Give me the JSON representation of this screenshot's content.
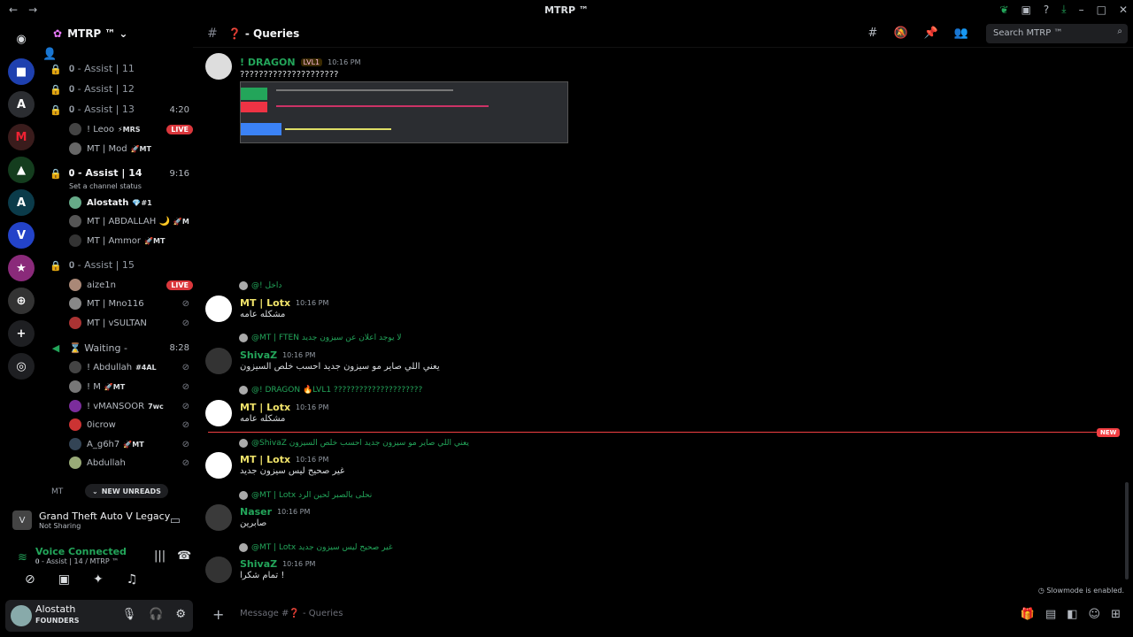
{
  "window": {
    "title": "MTRP ™"
  },
  "server": {
    "name": "MTRP ™"
  },
  "channel": {
    "name": "❓ - Queries"
  },
  "search": {
    "placeholder": "Search MTRP ™"
  },
  "channels": [
    {
      "label": "𝟎 - Assist | 11",
      "time": ""
    },
    {
      "label": "𝟎 - Assist | 12",
      "time": ""
    },
    {
      "label": "𝟎 - Assist | 13",
      "time": "4:20"
    },
    {
      "label": "𝟎 - Assist | 14",
      "time": "9:16"
    },
    {
      "label": "𝟎 - Assist | 15",
      "time": ""
    }
  ],
  "assist13_users": [
    {
      "name": "! Leoo",
      "tag": "⚡MRS",
      "live": "LIVE"
    },
    {
      "name": "MT | Mod",
      "tag": "🚀MT",
      "live": ""
    }
  ],
  "assist14_status": "Set a channel status",
  "assist14_users": [
    {
      "name": "Alostath",
      "tag": "💎#1"
    },
    {
      "name": "MT | ABDALLAH 🌙",
      "tag": "🚀M"
    },
    {
      "name": "MT | Ammor",
      "tag": "🚀MT"
    }
  ],
  "assist15_users": [
    {
      "name": "aize1n",
      "live": "LIVE"
    },
    {
      "name": "MT | Mno116",
      "live": ""
    },
    {
      "name": "MT | vSULTAN",
      "live": ""
    }
  ],
  "waiting": {
    "label": "⌛ Waiting -",
    "time": "8:28"
  },
  "waiting_users": [
    {
      "name": "! Abdullah",
      "tag": "#4AL"
    },
    {
      "name": "! M",
      "tag": "🚀MT"
    },
    {
      "name": "! vMANSOOR",
      "tag": "7wc"
    },
    {
      "name": "0icrow",
      "tag": ""
    },
    {
      "name": "A_g6h7",
      "tag": "🚀MT"
    },
    {
      "name": "Abdullah",
      "tag": ""
    }
  ],
  "category": "MT",
  "new_unreads": "NEW UNREADS",
  "activity": {
    "game": "Grand Theft Auto V Legacy",
    "status": "Not Sharing"
  },
  "voice": {
    "status": "Voice Connected",
    "location": "𝟎 - Assist | 14 / MTRP ™"
  },
  "user": {
    "name": "Alostath",
    "role": "FOUNDERS"
  },
  "messages": [
    {
      "name": "! DRAGON",
      "badge": "LVL1",
      "time": "10:16 PM",
      "text": "?????????????????????",
      "color": "#23a55a"
    },
    {
      "reply": "@! داخل",
      "name": "MT | Lotx",
      "time": "10:16 PM",
      "text": "مشكله عامه",
      "color": "#f0e36a"
    },
    {
      "reply": "@MT | FTEN لا يوجد اعلان عن سيزون جديد",
      "name": "ShivaZ",
      "time": "10:16 PM",
      "text": "يعني اللي صاير مو سيزون جديد  احسب خلص السيزون",
      "color": "#23a55a"
    },
    {
      "reply": "@! DRAGON 🔥LVL1 ?????????????????????",
      "name": "MT | Lotx",
      "time": "10:16 PM",
      "text": "مشكله عامه",
      "color": "#f0e36a"
    },
    {
      "reply": "@ShivaZ يعني اللي صاير مو سيزون جديد  احسب خلص السيزون",
      "name": "MT | Lotx",
      "time": "10:16 PM",
      "text": "غير صحيح ليس سيزون جديد",
      "color": "#f0e36a"
    },
    {
      "reply": "@MT | Lotx نحلى بالصبر لحين الرد",
      "name": "Naser",
      "time": "10:16 PM",
      "text": "صابرين",
      "color": "#23a55a"
    },
    {
      "reply": "@MT | Lotx غير صحيح ليس سيزون جديد",
      "name": "ShivaZ",
      "time": "10:16 PM",
      "text": "تمام شكرا !",
      "color": "#23a55a"
    }
  ],
  "new_tag": "NEW",
  "slowmode": "Slowmode is enabled.",
  "composer": {
    "placeholder": "Message #❓ - Queries"
  }
}
